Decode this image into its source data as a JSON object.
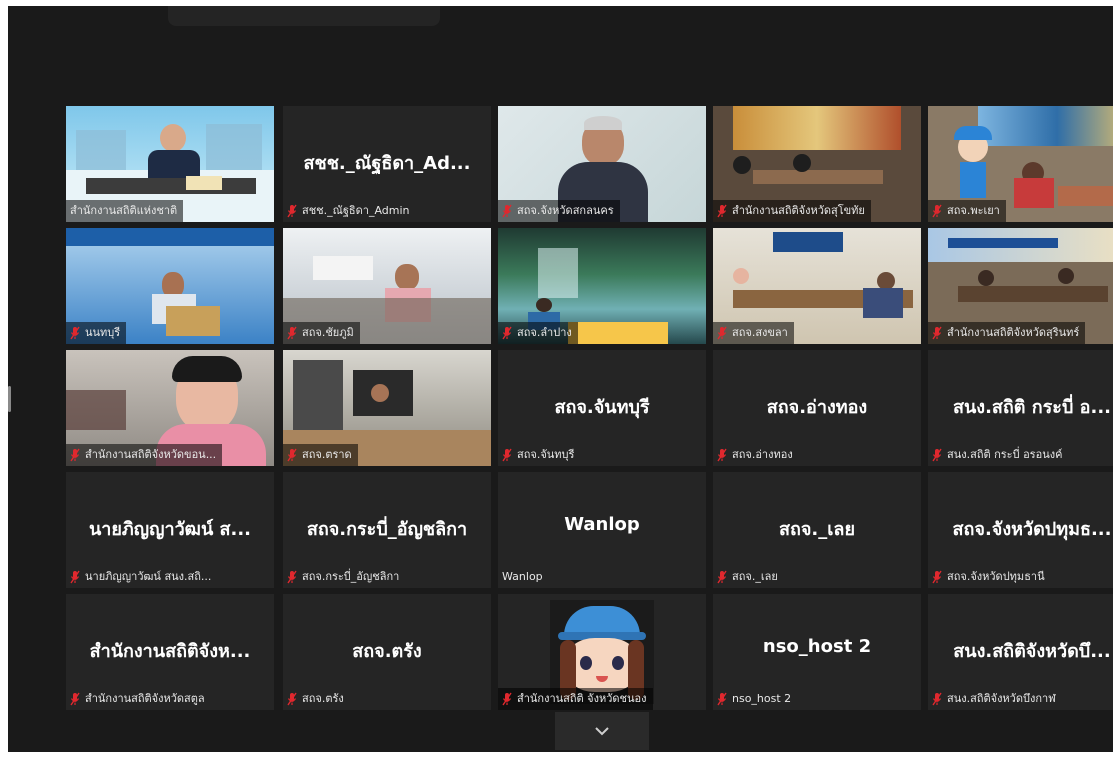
{
  "meeting": {
    "participants": [
      {
        "display": "",
        "label": "สำนักงานสถิติแห่งชาติ",
        "video": "office-blue",
        "muted": false,
        "active": true
      },
      {
        "display": "สชช._ณัฐธิดา_Ad...",
        "label": "สชช._ณัฐธิดา_Admin",
        "video": "",
        "muted": true,
        "active": false
      },
      {
        "display": "",
        "label": "สถจ.จังหวัดสกลนคร",
        "video": "man-whiteboard",
        "muted": true,
        "active": false
      },
      {
        "display": "",
        "label": "สำนักงานสถิติจังหวัดสุโขทัย",
        "video": "meeting-room-banner",
        "muted": true,
        "active": false
      },
      {
        "display": "",
        "label": "สถจ.พะเยา",
        "video": "mascot-banner",
        "muted": true,
        "active": false
      },
      {
        "display": "",
        "label": "นนทบุรี",
        "video": "man-laptop-blue",
        "muted": true,
        "active": false
      },
      {
        "display": "",
        "label": "สถจ.ชัยภูมิ",
        "video": "office-man-pink",
        "muted": true,
        "active": false
      },
      {
        "display": "",
        "label": "สถจ.ลำปาง",
        "video": "waterfall",
        "muted": true,
        "active": false
      },
      {
        "display": "",
        "label": "สถจ.สงขลา",
        "video": "conference-table",
        "muted": true,
        "active": false
      },
      {
        "display": "",
        "label": "สำนักงานสถิติจังหวัดสุรินทร์",
        "video": "conference-banner",
        "muted": true,
        "active": false
      },
      {
        "display": "",
        "label": "สำนักงานสถิติจังหวัดขอน...",
        "video": "man-closeup",
        "muted": true,
        "active": false
      },
      {
        "display": "",
        "label": "สถจ.ตราด",
        "video": "office-desk",
        "muted": true,
        "active": false
      },
      {
        "display": "สถจ.จันทบุรี",
        "label": "สถจ.จันทบุรี",
        "video": "",
        "muted": true,
        "active": false
      },
      {
        "display": "สถจ.อ่างทอง",
        "label": "สถจ.อ่างทอง",
        "video": "",
        "muted": true,
        "active": false
      },
      {
        "display": "สนง.สถิติ กระบี่ อ...",
        "label": "สนง.สถิติ กระบี่ อรอนงค์",
        "video": "",
        "muted": true,
        "active": false
      },
      {
        "display": "นายภิญญาวัฒน์ ส...",
        "label": "นายภิญญาวัฒน์ สนง.สถิ...",
        "video": "",
        "muted": true,
        "active": false
      },
      {
        "display": "สถจ.กระบี่_อัญชลิกา",
        "label": "สถจ.กระบี่_อัญชลิกา",
        "video": "",
        "muted": true,
        "active": false
      },
      {
        "display": "Wanlop",
        "label": "Wanlop",
        "video": "",
        "muted": false,
        "active": false
      },
      {
        "display": "สถจ._เลย",
        "label": "สถจ._เลย",
        "video": "",
        "muted": true,
        "active": false
      },
      {
        "display": "สถจ.จังหวัดปทุมธ...",
        "label": "สถจ.จังหวัดปทุมธานี",
        "video": "",
        "muted": true,
        "active": false
      },
      {
        "display": "สำนักงานสถิติจังห...",
        "label": "สำนักงานสถิติจังหวัดสตูล",
        "video": "",
        "muted": true,
        "active": false
      },
      {
        "display": "สถจ.ตรัง",
        "label": "สถจ.ตรัง",
        "video": "",
        "muted": true,
        "active": false
      },
      {
        "display": "",
        "label": "สำนักงานสถิติ จังหวัดชนอง",
        "video": "cartoon-avatar",
        "muted": true,
        "active": false
      },
      {
        "display": "nso_host 2",
        "label": "nso_host 2",
        "video": "",
        "muted": true,
        "active": false
      },
      {
        "display": "สนง.สถิติจังหวัดบึ...",
        "label": "สนง.สถิติจังหวัดบึงกาฬ",
        "video": "",
        "muted": true,
        "active": false
      }
    ]
  },
  "colors": {
    "background": "#1a1a1a",
    "tile": "#252525",
    "active_border": "#b7e33a",
    "muted_mic": "#e0282e"
  },
  "icons": {
    "muted": "microphone-muted-icon",
    "more": "chevron-down-icon"
  }
}
